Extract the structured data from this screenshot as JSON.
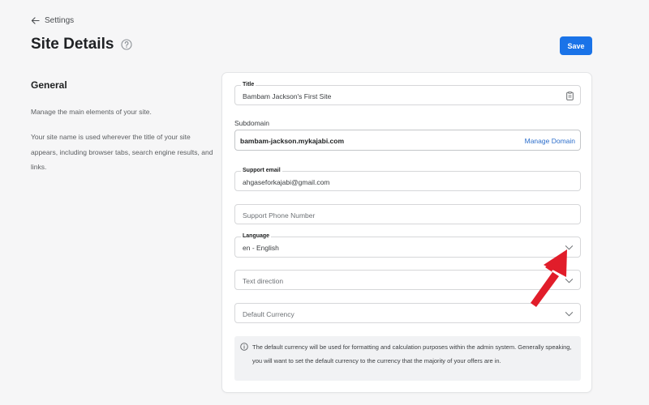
{
  "nav": {
    "back_label": "Settings"
  },
  "header": {
    "title": "Site Details",
    "save_label": "Save"
  },
  "section": {
    "title": "General",
    "description_1": "Manage the main elements of your site.",
    "description_2": "Your site name is used wherever the title of your site appears, including browser tabs, search engine results, and links."
  },
  "form": {
    "title_label": "Title",
    "title_value": "Bambam Jackson's First Site",
    "subdomain_label": "Subdomain",
    "subdomain_value": "bambam-jackson.mykajabi.com",
    "manage_domain_label": "Manage Domain",
    "support_email_label": "Support email",
    "support_email_value": "ahgaseforkajabi@gmail.com",
    "support_phone_placeholder": "Support Phone Number",
    "language_label": "Language",
    "language_value": "en - English",
    "text_direction_placeholder": "Text direction",
    "currency_placeholder": "Default Currency",
    "info_text": "The default currency will be used for formatting and calculation purposes within the admin system. Generally speaking, you will want to set the default currency to the currency that the majority of your offers are in."
  },
  "colors": {
    "accent": "#1a73e8",
    "link": "#2c6ecb",
    "annotation_arrow": "#e11d2a"
  },
  "icons": [
    "arrow-left-icon",
    "help-circle-icon",
    "clipboard-icon",
    "chevron-down-icon",
    "info-icon"
  ]
}
